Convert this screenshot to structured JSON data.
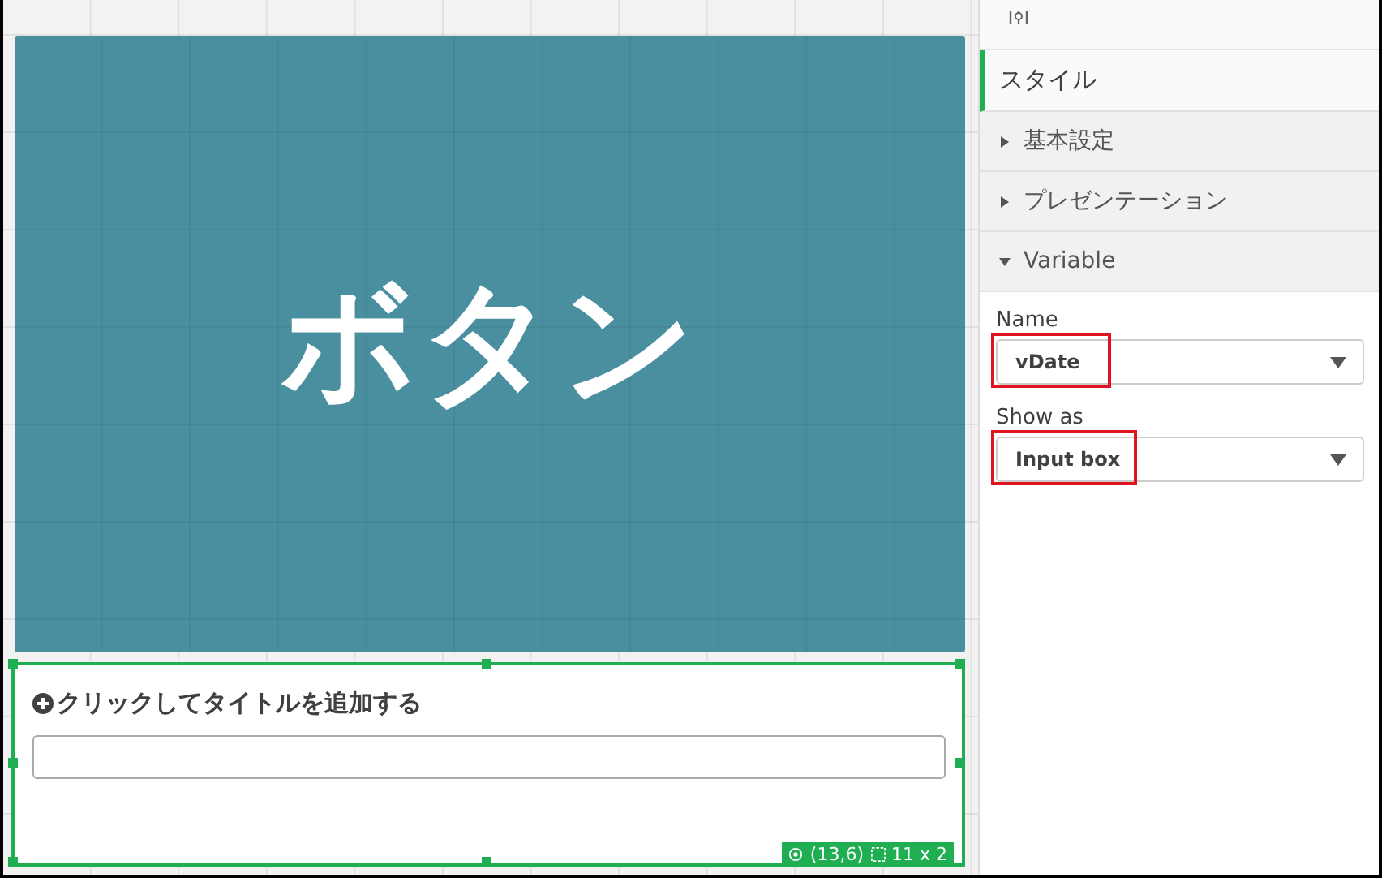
{
  "button_tile": {
    "label": "ボタン"
  },
  "input_object": {
    "title": "クリックしてタイトルを追加する",
    "selected": true,
    "position": "(13,6)",
    "size": "11 x 2"
  },
  "properties_panel": {
    "sections": [
      {
        "kind": "tab",
        "label": "スタイル",
        "selected": true
      },
      {
        "kind": "accordion",
        "label": "基本設定",
        "expanded": false
      },
      {
        "kind": "accordion",
        "label": "プレゼンテーション",
        "expanded": false
      },
      {
        "kind": "accordion",
        "label": "Variable",
        "expanded": true
      }
    ],
    "fields": [
      {
        "label": "Name",
        "value": "vDate",
        "highlighted": true
      },
      {
        "label": "Show as",
        "value": "Input box",
        "highlighted": true
      }
    ]
  }
}
